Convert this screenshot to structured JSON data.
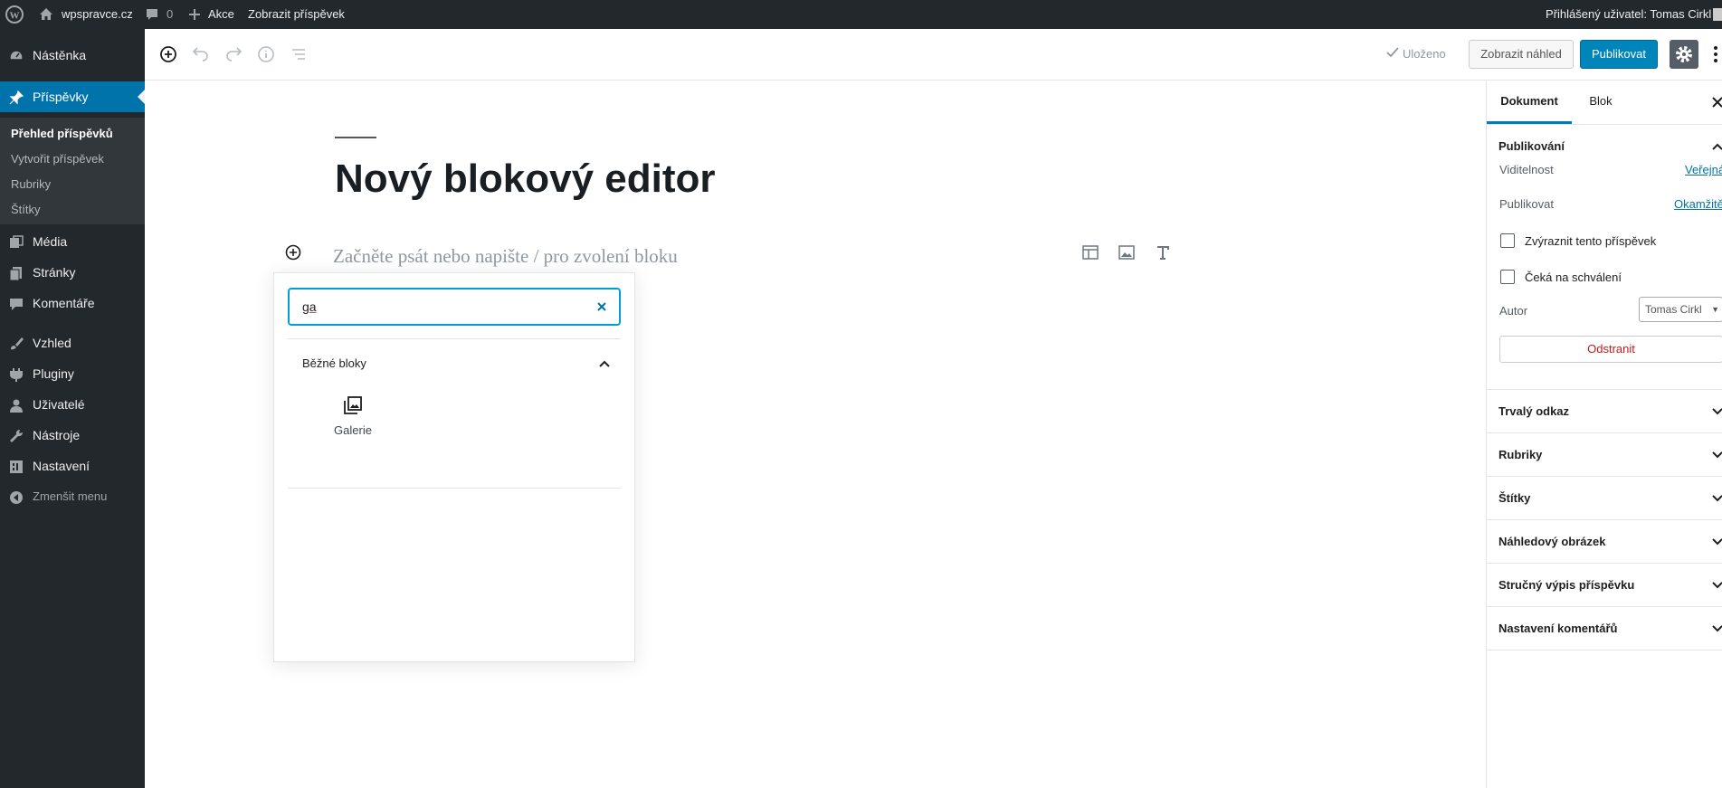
{
  "admin_bar": {
    "site_name": "wpspravce.cz",
    "comments_count": "0",
    "new_label": "Akce",
    "view_post": "Zobrazit příspěvek",
    "greeting": "Přihlášený uživatel: Tomas Cirkl"
  },
  "sidebar": {
    "items": [
      {
        "label": "Nástěnka",
        "icon": "dashboard-icon"
      },
      {
        "label": "Příspěvky",
        "icon": "pin-icon"
      },
      {
        "label": "Média",
        "icon": "media-icon"
      },
      {
        "label": "Stránky",
        "icon": "pages-icon"
      },
      {
        "label": "Komentáře",
        "icon": "comment-icon"
      },
      {
        "label": "Vzhled",
        "icon": "brush-icon"
      },
      {
        "label": "Pluginy",
        "icon": "plugin-icon"
      },
      {
        "label": "Uživatelé",
        "icon": "user-icon"
      },
      {
        "label": "Nástroje",
        "icon": "wrench-icon"
      },
      {
        "label": "Nastavení",
        "icon": "settings-icon"
      },
      {
        "label": "Zmenšit menu",
        "icon": "collapse-icon"
      }
    ],
    "submenu": [
      "Přehled příspěvků",
      "Vytvořit příspěvek",
      "Rubriky",
      "Štítky"
    ]
  },
  "header": {
    "saved_label": "Uloženo",
    "preview_label": "Zobrazit náhled",
    "publish_label": "Publikovat"
  },
  "editor": {
    "title": "Nový blokový editor",
    "placeholder": "Začněte psát nebo napište / pro zvolení bloku"
  },
  "inserter": {
    "search_value": "ga",
    "category_label": "Běžné bloky",
    "result_label": "Galerie"
  },
  "panel": {
    "tabs": [
      "Dokument",
      "Blok"
    ],
    "publish_section": "Publikování",
    "visibility_label": "Viditelnost",
    "visibility_value": "Veřejná",
    "publish_label": "Publikovat",
    "publish_value": "Okamžitě",
    "sticky_label": "Zvýraznit tento příspěvek",
    "pending_label": "Čeká na schválení",
    "author_label": "Autor",
    "author_value": "Tomas Cirkl",
    "delete_label": "Odstranit",
    "sections": [
      "Trvalý odkaz",
      "Rubriky",
      "Štítky",
      "Náhledový obrázek",
      "Stručný výpis příspěvku",
      "Nastavení komentářů"
    ]
  },
  "colors": {
    "accent": "#0073aa",
    "admin_bg": "#23282d",
    "delete": "#cc1818"
  }
}
